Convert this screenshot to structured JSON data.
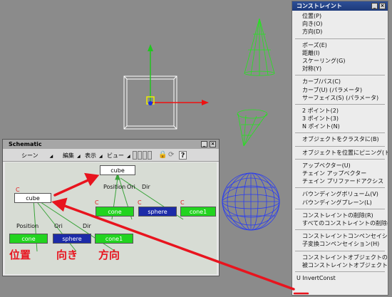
{
  "menu": {
    "title": "コンストレイント",
    "items": [
      "位置(P)",
      "向き(O)",
      "方向(D)",
      "-",
      "ポーズ(E)",
      "距離(I)",
      "スケーリング(G)",
      "対称(Y)",
      "-",
      "カーブ/パス(C)",
      "カーブ(U) (パラメータ)",
      "サーフェイス(S) (パラメータ)",
      "-",
      "2 ポイント(2)",
      "3 ポイント(3)",
      "N ポイント(N)",
      "-",
      "オブジェクトをクラスタに(B)",
      "-",
      "オブジェクトを位置にピニング(トグル)",
      "-",
      "アップベクター(U)",
      "チェイン アップベクター",
      "チェイン プリファードアクシス",
      "-",
      "バウンディングボリューム(V)",
      "バウンディングプレーン(L)",
      "-",
      "コンストレイントの削除(R)",
      "すべてのコンストレイントの削除(A)",
      "-",
      "コンストレイントコンペンセイション(M)",
      "子変換コンペンセイション(H)",
      "-",
      "コンストレイントオブジェクトの選択(F)",
      "被コンストレイントオブジェクトの選択",
      "-",
      "U  InvertConst"
    ]
  },
  "schematic": {
    "title": "Schematic",
    "toolbar": {
      "scene": "シーン",
      "edit": "編集",
      "display": "表示",
      "view": "ビュー"
    },
    "nodes": {
      "cube_top": "cube",
      "cube_left": "cube",
      "cone_a": "cone",
      "sphere_a": "sphere",
      "cone1_a": "cone1",
      "cone_b": "cone",
      "sphere_b": "sphere",
      "cone1_b": "cone1"
    },
    "labels": {
      "position_top": "Position",
      "ori_top": "Ori",
      "dir_top": "Dir",
      "position_left": "Position",
      "ori_left": "Ori",
      "dir_left": "Dir",
      "c": "C"
    },
    "jp": {
      "position": "位置",
      "orientation": "向き",
      "direction": "方向"
    }
  },
  "colors": {
    "accent_red": "#e8141e",
    "node_green": "#22d41f",
    "node_blue": "#1c2ba8",
    "wire_green": "#22e61c",
    "wire_blue": "#2a3cf0"
  }
}
